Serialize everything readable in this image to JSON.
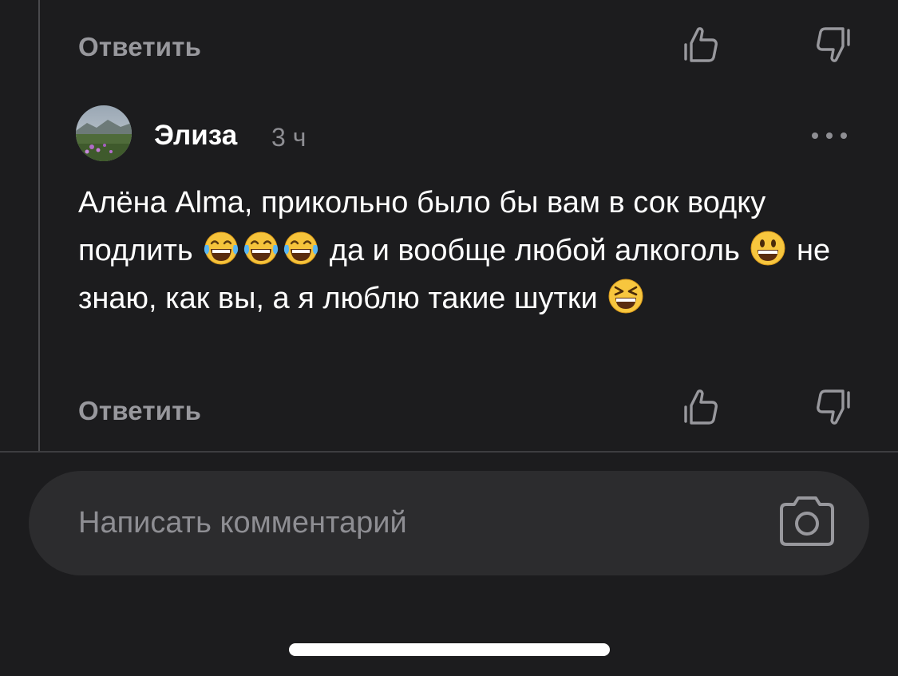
{
  "thread": {
    "previous_reply_label": "Ответить"
  },
  "comment": {
    "author": "Элиза",
    "time": "3 ч",
    "text_segments": [
      "Алёна Alma, прикольно было бы вам в сок водку подлить",
      "да и вообще любой алкоголь",
      "не знаю, как вы, а я люблю такие шутки"
    ],
    "emojis": [
      "tears-of-joy-emoji",
      "tears-of-joy-emoji",
      "tears-of-joy-emoji",
      "grinning-face-emoji",
      "squinting-laughing-emoji"
    ],
    "reply_label": "Ответить"
  },
  "composer": {
    "placeholder": "Написать комментарий"
  },
  "icons": {
    "like": "thumbs-up-icon",
    "dislike": "thumbs-down-icon",
    "more": "more-dots-icon",
    "camera": "camera-icon"
  },
  "colors": {
    "background": "#1c1c1e",
    "secondary_text": "#98989d",
    "input_background": "#2c2c2e"
  }
}
